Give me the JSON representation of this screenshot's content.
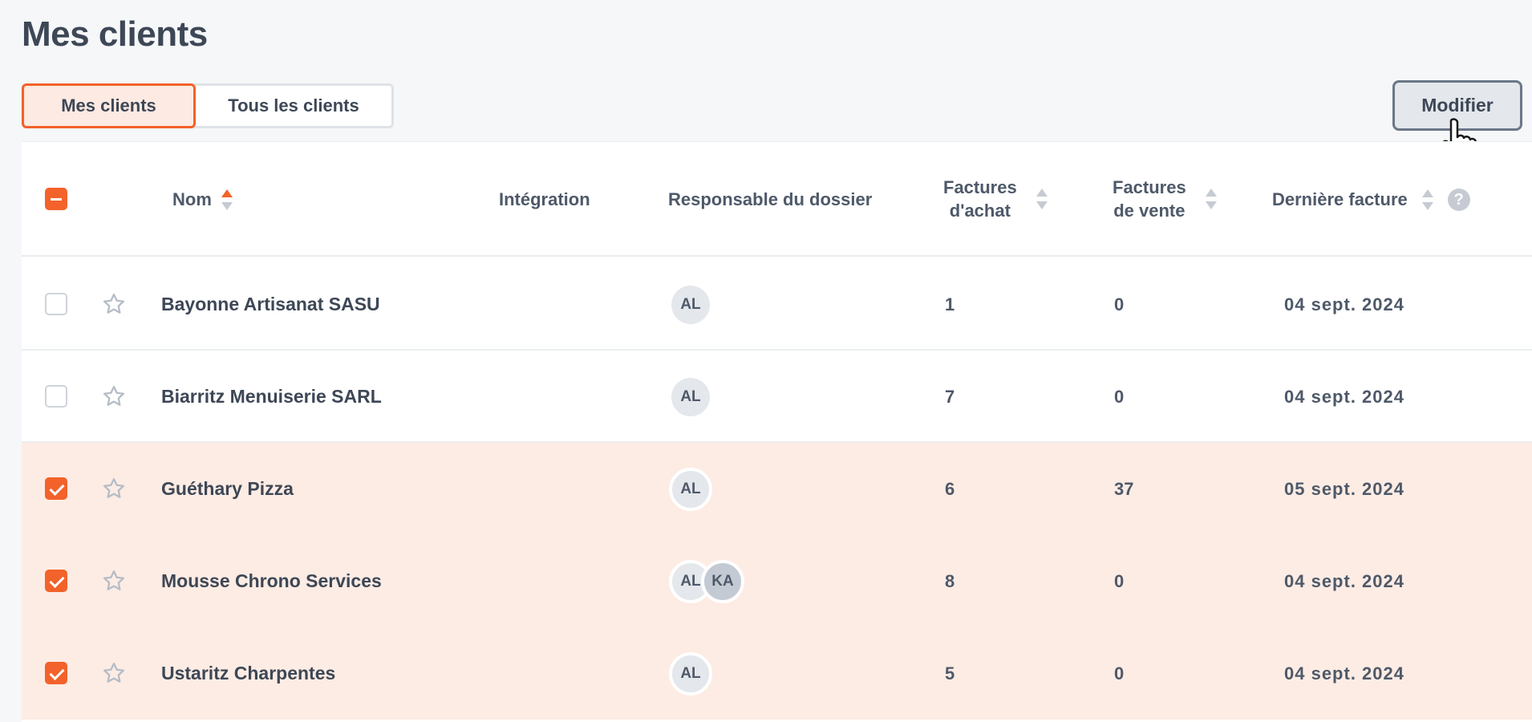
{
  "page": {
    "title": "Mes clients"
  },
  "tabs": [
    {
      "label": "Mes clients",
      "active": true
    },
    {
      "label": "Tous les clients",
      "active": false
    }
  ],
  "actions": {
    "modify_label": "Modifier"
  },
  "table": {
    "columns": {
      "name": "Nom",
      "integration": "Intégration",
      "owner": "Responsable du dossier",
      "purchase_line1": "Factures",
      "purchase_line2": "d'achat",
      "sales_line1": "Factures",
      "sales_line2": "de vente",
      "last_invoice": "Dernière facture",
      "help_icon": "?"
    },
    "rows": [
      {
        "name": "Bayonne Artisanat SASU",
        "owners": [
          "AL"
        ],
        "purchase": "1",
        "sales": "0",
        "last_invoice": "04 sept. 2024",
        "selected": false
      },
      {
        "name": "Biarritz Menuiserie SARL",
        "owners": [
          "AL"
        ],
        "purchase": "7",
        "sales": "0",
        "last_invoice": "04 sept. 2024",
        "selected": false
      },
      {
        "name": "Guéthary Pizza",
        "owners": [
          "AL"
        ],
        "purchase": "6",
        "sales": "37",
        "last_invoice": "05 sept. 2024",
        "selected": true
      },
      {
        "name": "Mousse Chrono Services",
        "owners": [
          "AL",
          "KA"
        ],
        "purchase": "8",
        "sales": "0",
        "last_invoice": "04 sept. 2024",
        "selected": true
      },
      {
        "name": "Ustaritz Charpentes",
        "owners": [
          "AL"
        ],
        "purchase": "5",
        "sales": "0",
        "last_invoice": "04 sept. 2024",
        "selected": true
      }
    ]
  },
  "colors": {
    "accent": "#f2622a",
    "selected_row": "#fdece4",
    "text": "#3d4756"
  }
}
